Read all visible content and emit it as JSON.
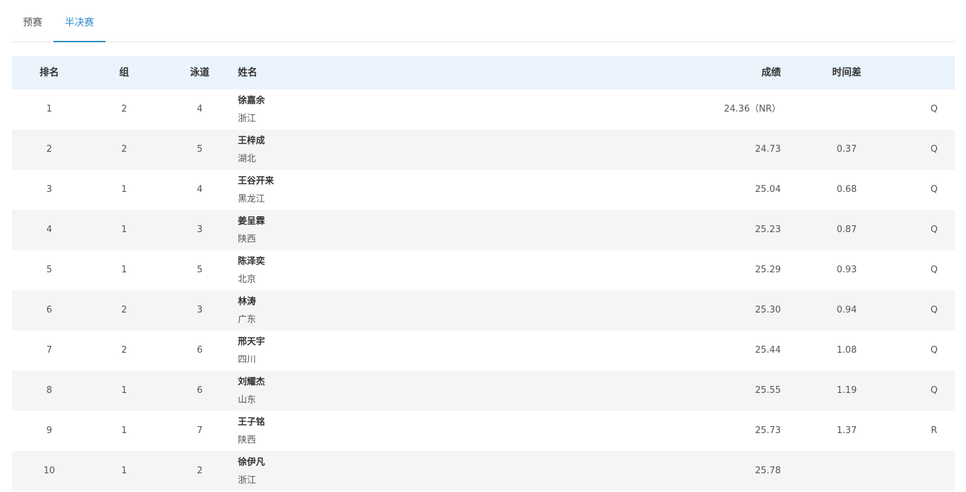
{
  "tabs": [
    {
      "label": "预赛",
      "active": false
    },
    {
      "label": "半决赛",
      "active": true
    }
  ],
  "accent_color": "#2d8bc6",
  "table": {
    "headers": {
      "rank": "排名",
      "group": "组",
      "lane": "泳道",
      "name": "姓名",
      "score": "成绩",
      "diff": "时间差"
    },
    "rows": [
      {
        "rank": "1",
        "group": "2",
        "lane": "4",
        "name": "徐嘉余",
        "province": "浙江",
        "score": "24.36（NR）",
        "diff": "",
        "q": "Q"
      },
      {
        "rank": "2",
        "group": "2",
        "lane": "5",
        "name": "王梓成",
        "province": "湖北",
        "score": "24.73",
        "diff": "0.37",
        "q": "Q"
      },
      {
        "rank": "3",
        "group": "1",
        "lane": "4",
        "name": "王谷开来",
        "province": "黑龙江",
        "score": "25.04",
        "diff": "0.68",
        "q": "Q"
      },
      {
        "rank": "4",
        "group": "1",
        "lane": "3",
        "name": "姜呈霖",
        "province": "陕西",
        "score": "25.23",
        "diff": "0.87",
        "q": "Q"
      },
      {
        "rank": "5",
        "group": "1",
        "lane": "5",
        "name": "陈泽奕",
        "province": "北京",
        "score": "25.29",
        "diff": "0.93",
        "q": "Q"
      },
      {
        "rank": "6",
        "group": "2",
        "lane": "3",
        "name": "林涛",
        "province": "广东",
        "score": "25.30",
        "diff": "0.94",
        "q": "Q"
      },
      {
        "rank": "7",
        "group": "2",
        "lane": "6",
        "name": "邢天宇",
        "province": "四川",
        "score": "25.44",
        "diff": "1.08",
        "q": "Q"
      },
      {
        "rank": "8",
        "group": "1",
        "lane": "6",
        "name": "刘耀杰",
        "province": "山东",
        "score": "25.55",
        "diff": "1.19",
        "q": "Q"
      },
      {
        "rank": "9",
        "group": "1",
        "lane": "7",
        "name": "王子铭",
        "province": "陕西",
        "score": "25.73",
        "diff": "1.37",
        "q": "R"
      },
      {
        "rank": "10",
        "group": "1",
        "lane": "2",
        "name": "徐伊凡",
        "province": "浙江",
        "score": "25.78",
        "diff": "",
        "q": ""
      }
    ]
  }
}
